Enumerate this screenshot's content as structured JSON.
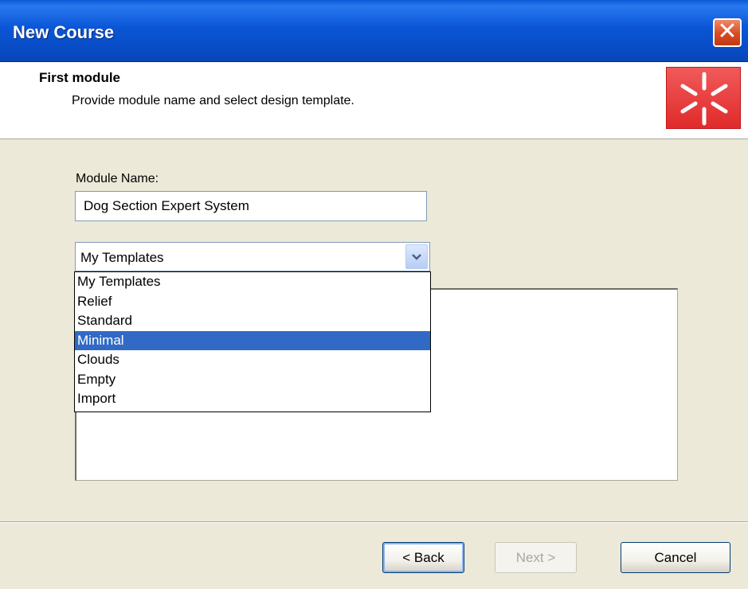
{
  "window": {
    "title": "New Course",
    "close_label": "✕"
  },
  "header": {
    "title": "First module",
    "subtitle": "Provide module name and select design template."
  },
  "form": {
    "module_name_label": "Module Name:",
    "module_name_value": "Dog Section Expert System",
    "template_selected": "My Templates",
    "template_options": [
      "My Templates",
      "Relief",
      "Standard",
      "Minimal",
      "Clouds",
      "Empty",
      "Import"
    ],
    "highlighted_option_index": 3
  },
  "buttons": {
    "back": "< Back",
    "next": "Next >",
    "cancel": "Cancel"
  },
  "colors": {
    "titlebar": "#0a56d6",
    "selection": "#316ac5",
    "logo": "#e02a2a"
  },
  "icons": {
    "logo": "star-burst-icon",
    "combo_arrow": "chevron-down-icon",
    "close": "close-icon"
  }
}
